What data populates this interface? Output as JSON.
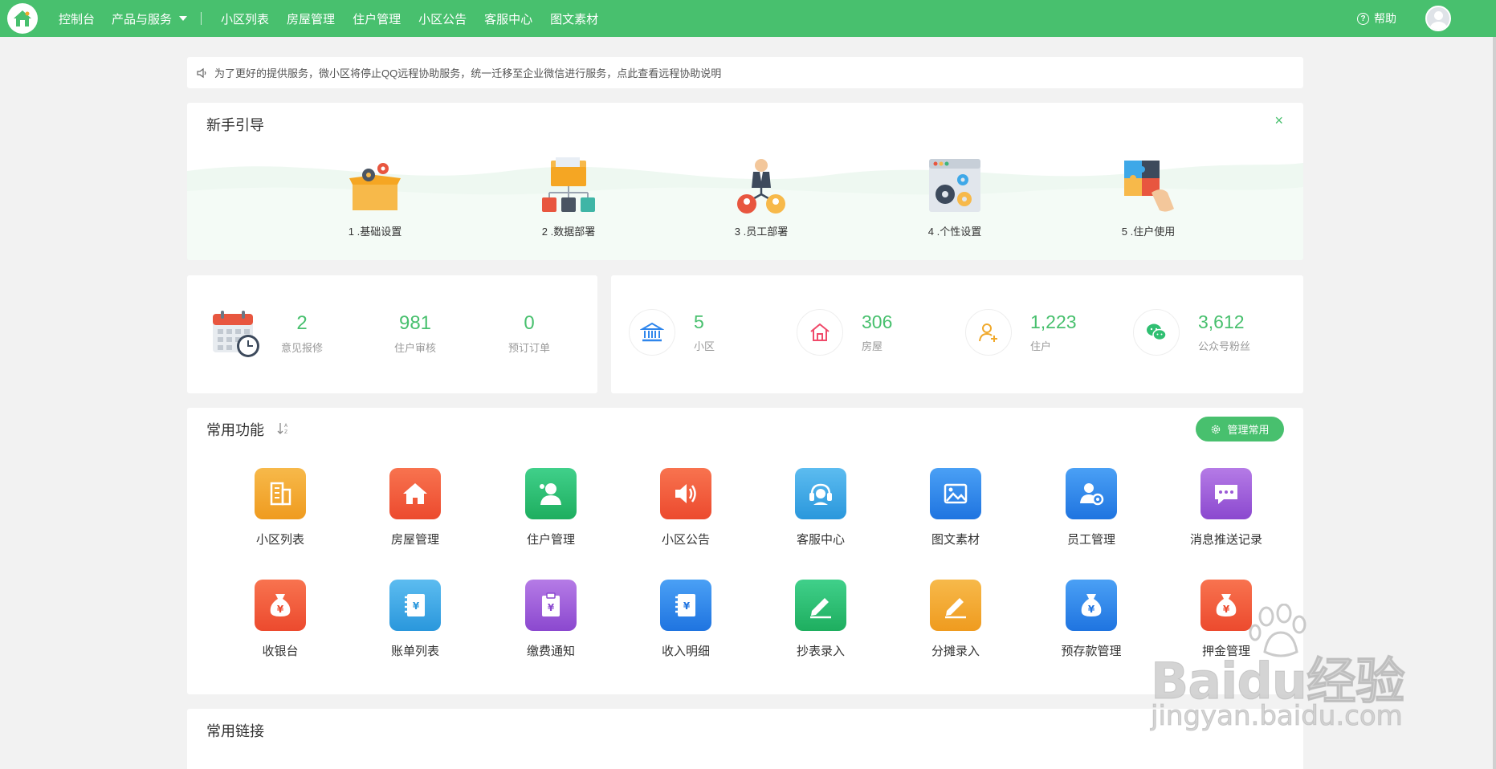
{
  "topbar": {
    "console": "控制台",
    "products": "产品与服务",
    "nav": [
      "小区列表",
      "房屋管理",
      "住户管理",
      "小区公告",
      "客服中心",
      "图文素材"
    ],
    "help": "帮助",
    "accent": "#48c06e"
  },
  "notice": {
    "text": "为了更好的提供服务，微小区将停止QQ远程协助服务，统一迁移至企业微信进行服务，点此查看远程协助说明"
  },
  "guide": {
    "title": "新手引导",
    "close": "×",
    "steps": [
      "1 .基础设置",
      "2 .数据部署",
      "3 .员工部署",
      "4 .个性设置",
      "5 .住户使用"
    ]
  },
  "stats_left": [
    {
      "value": "2",
      "label": "意见报修"
    },
    {
      "value": "981",
      "label": "住户审核"
    },
    {
      "value": "0",
      "label": "预订订单"
    }
  ],
  "stats_right": [
    {
      "value": "5",
      "label": "小区",
      "icon": "bank-icon"
    },
    {
      "value": "306",
      "label": "房屋",
      "icon": "house-icon"
    },
    {
      "value": "1,223",
      "label": "住户",
      "icon": "user-add-icon"
    },
    {
      "value": "3,612",
      "label": "公众号粉丝",
      "icon": "wechat-icon"
    }
  ],
  "functions": {
    "title": "常用功能",
    "manage": "管理常用",
    "items": [
      {
        "label": "小区列表",
        "icon": "building-icon",
        "color": "#f0a92c"
      },
      {
        "label": "房屋管理",
        "icon": "home-icon",
        "color": "#f2583a"
      },
      {
        "label": "住户管理",
        "icon": "resident-icon",
        "color": "#2fbf71"
      },
      {
        "label": "小区公告",
        "icon": "speaker-icon",
        "color": "#f2583a"
      },
      {
        "label": "客服中心",
        "icon": "headset-icon",
        "color": "#3ea8e8"
      },
      {
        "label": "图文素材",
        "icon": "image-icon",
        "color": "#2f86ec"
      },
      {
        "label": "员工管理",
        "icon": "staff-icon",
        "color": "#2f86ec"
      },
      {
        "label": "消息推送记录",
        "icon": "message-icon",
        "color": "#9b59d6"
      },
      {
        "label": "收银台",
        "icon": "money-bag-icon",
        "color": "#f2583a"
      },
      {
        "label": "账单列表",
        "icon": "bill-book-icon",
        "color": "#3ea8e8"
      },
      {
        "label": "缴费通知",
        "icon": "payment-notice-icon",
        "color": "#9b59d6"
      },
      {
        "label": "收入明细",
        "icon": "income-book-icon",
        "color": "#2f86ec"
      },
      {
        "label": "抄表录入",
        "icon": "meter-edit-icon",
        "color": "#2fbf71"
      },
      {
        "label": "分摊录入",
        "icon": "share-edit-icon",
        "color": "#f0a92c"
      },
      {
        "label": "预存款管理",
        "icon": "deposit-bag-icon",
        "color": "#2f86ec"
      },
      {
        "label": "押金管理",
        "icon": "guarantee-bag-icon",
        "color": "#f2583a"
      }
    ]
  },
  "links": {
    "title": "常用链接"
  },
  "watermark": {
    "brand": "Baidu经验",
    "url": "jingyan.baidu.com"
  }
}
